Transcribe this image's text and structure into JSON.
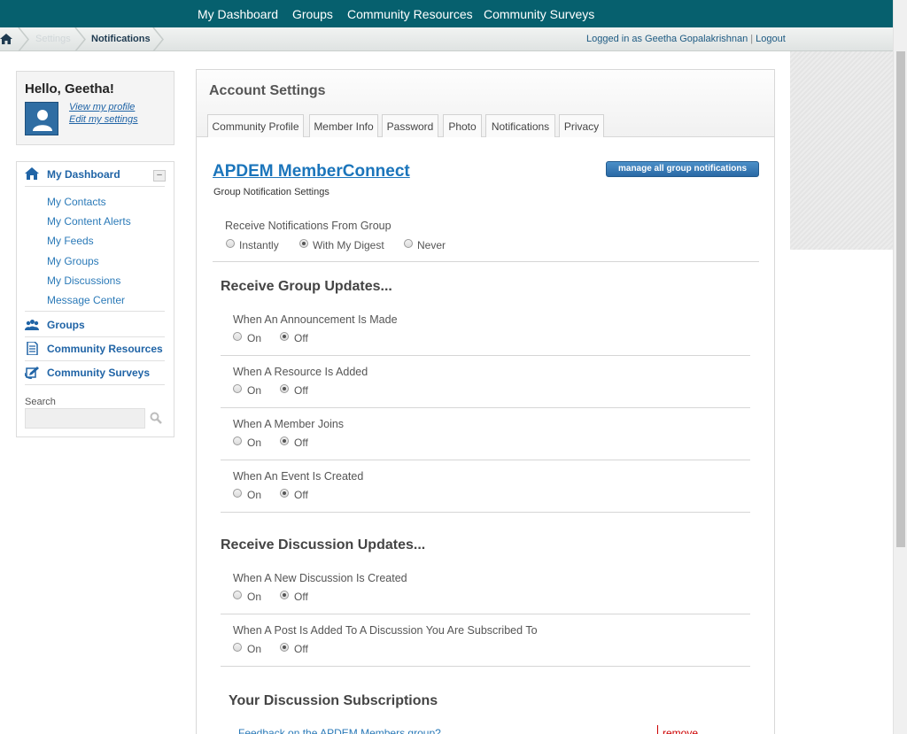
{
  "topnav": {
    "items": [
      "My Dashboard",
      "Groups",
      "Community Resources",
      "Community Surveys"
    ]
  },
  "breadcrumb": {
    "settings": "Settings",
    "current": "Notifications"
  },
  "login": {
    "text": "Logged in as Geetha Gopalakrishnan",
    "logout": "Logout"
  },
  "sidebar": {
    "hello": "Hello, Geetha!",
    "view_profile": "View my profile",
    "edit_settings": "Edit my settings",
    "dashboard": "My Dashboard",
    "collapse": "–",
    "sub_items": [
      "My Contacts",
      "My Content Alerts",
      "My Feeds",
      "My Groups",
      "My Discussions",
      "Message Center"
    ],
    "groups": "Groups",
    "resources": "Community Resources",
    "surveys": "Community Surveys",
    "search_label": "Search"
  },
  "main": {
    "title": "Account Settings",
    "tabs": [
      "Community Profile",
      "Member Info",
      "Password",
      "Photo",
      "Notifications",
      "Privacy"
    ],
    "group_title": "APDEM MemberConnect",
    "group_sub": "Group Notification Settings",
    "manage_button": "manage all group notifications",
    "receive_label": "Receive Notifications From Group",
    "receive_options": [
      "Instantly",
      "With My Digest",
      "Never"
    ],
    "receive_selected": 1,
    "group_updates_title": "Receive Group Updates...",
    "group_updates": [
      {
        "label": "When An Announcement Is Made",
        "on": "On",
        "off": "Off",
        "selected": "off"
      },
      {
        "label": "When A Resource Is Added",
        "on": "On",
        "off": "Off",
        "selected": "off"
      },
      {
        "label": "When A Member Joins",
        "on": "On",
        "off": "Off",
        "selected": "off"
      },
      {
        "label": "When An Event Is Created",
        "on": "On",
        "off": "Off",
        "selected": "off"
      }
    ],
    "discussion_updates_title": "Receive Discussion Updates...",
    "discussion_updates": [
      {
        "label": "When A New Discussion Is Created",
        "on": "On",
        "off": "Off",
        "selected": "off"
      },
      {
        "label": "When A Post Is Added To A Discussion You Are Subscribed To",
        "on": "On",
        "off": "Off",
        "selected": "off"
      }
    ],
    "subscriptions_title": "Your Discussion Subscriptions",
    "subscription": {
      "title": "Feedback on the APDEM Members group?",
      "remove": "remove"
    }
  },
  "colors": {
    "topnav": "#06606e",
    "link": "#2064a6",
    "remove": "#cc0000"
  }
}
